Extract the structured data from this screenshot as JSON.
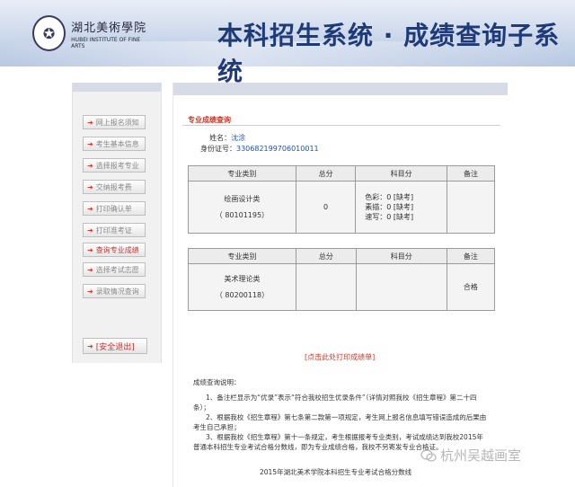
{
  "header": {
    "logo_cn": "湖北美術學院",
    "logo_en": "HUBEI INSTITUTE OF FINE ARTS",
    "title": "本科招生系统 · 成绩查询子系统"
  },
  "sidebar": {
    "items": [
      {
        "label": "网上报名须知"
      },
      {
        "label": "考生基本信息"
      },
      {
        "label": "选择报考专业"
      },
      {
        "label": "交纳报考费"
      },
      {
        "label": "打印确认单"
      },
      {
        "label": "打印准考证"
      },
      {
        "label": "查询专业成绩"
      },
      {
        "label": "选择考试志愿"
      },
      {
        "label": "录取情况查询"
      }
    ],
    "logout": "[安全退出]"
  },
  "main": {
    "section_title": "专业成绩查询",
    "name_label": "姓名：",
    "name_value": "沈涂",
    "id_label": "身份证号：",
    "id_value": "330682199706010011",
    "table_headers": [
      "专业类别",
      "总分",
      "科目分",
      "备注"
    ],
    "tables": [
      {
        "category": "绘画设计类",
        "code": "（ 80101195）",
        "total": "0",
        "subjects": [
          "色彩：0 [缺考]",
          "素描：0 [缺考]",
          "速写：0 [缺考]"
        ],
        "remark": ""
      },
      {
        "category": "美术理论类",
        "code": "（ 80200118）",
        "total": "",
        "subjects": [],
        "remark": "合格"
      }
    ],
    "print_link": "[点击此处打印成绩单]",
    "notes_head": "成绩查询说明：",
    "notes": [
      "1、备注栏显示为“优录”表示“符合我校招生优录条件”（详情对照我校《招生章程》第二十四条）；",
      "2、根据我校《招生章程》第七条第二款第一项规定，考生网上报名信息填写错误造成的后果由考生自己承担；",
      "3、根据我校《招生章程》第十一条规定，考生根据报考专业类别，考试成绩达到我校2015年普通本科招生专业考试合格分数线，即为专业成绩合格，我校不另寄发专业合格证。"
    ],
    "footer": "2015年湖北美术学院本科招生专业考试合格分数线"
  },
  "watermark": "杭州吴越画室"
}
